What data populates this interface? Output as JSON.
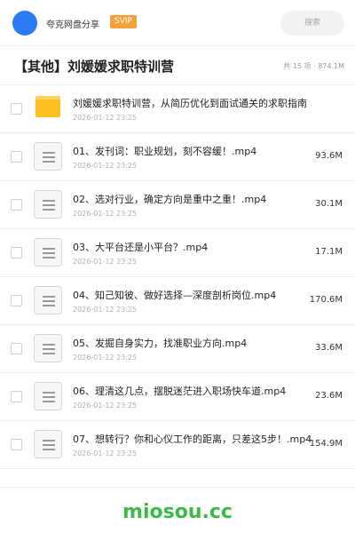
{
  "header": {
    "brand": "夸克网盘分享",
    "badge": "SVIP",
    "search_placeholder": "搜索"
  },
  "page": {
    "title": "【其他】刘媛媛求职特训营",
    "meta": "共 15 项 · 874.1M"
  },
  "files": [
    {
      "name": "刘媛媛求职特训营，从简历优化到面试通关的求职指南",
      "date": "2026-01-12 23:25",
      "size": "",
      "type": "folder"
    },
    {
      "name": "01、发刊词：职业规划，刻不容缓！.mp4",
      "date": "2026-01-12 23:25",
      "size": "93.6M",
      "type": "file"
    },
    {
      "name": "02、选对行业，确定方向是重中之重！.mp4",
      "date": "2026-01-12 23:25",
      "size": "30.1M",
      "type": "file"
    },
    {
      "name": "03、大平台还是小平台？.mp4",
      "date": "2026-01-12 23:25",
      "size": "17.1M",
      "type": "file"
    },
    {
      "name": "04、知己知彼、做好选择—深度剖析岗位.mp4",
      "date": "2026-01-12 23:25",
      "size": "170.6M",
      "type": "file"
    },
    {
      "name": "05、发掘自身实力，找准职业方向.mp4",
      "date": "2026-01-12 23:25",
      "size": "33.6M",
      "type": "file"
    },
    {
      "name": "06、理清这几点，摆脱迷茫进入职场快车道.mp4",
      "date": "2026-01-12 23:25",
      "size": "23.6M",
      "type": "file"
    },
    {
      "name": "07、想转行？你和心仪工作的距离，只差这5步！.mp4",
      "date": "2026-01-12 23:25",
      "size": "154.9M",
      "type": "file"
    }
  ],
  "watermark": "miosou.cc",
  "colors": {
    "avatar": "#2b7bf3",
    "badge": "#f5a13b",
    "folder": "#fbbf20",
    "watermark": "#3cb94a"
  }
}
